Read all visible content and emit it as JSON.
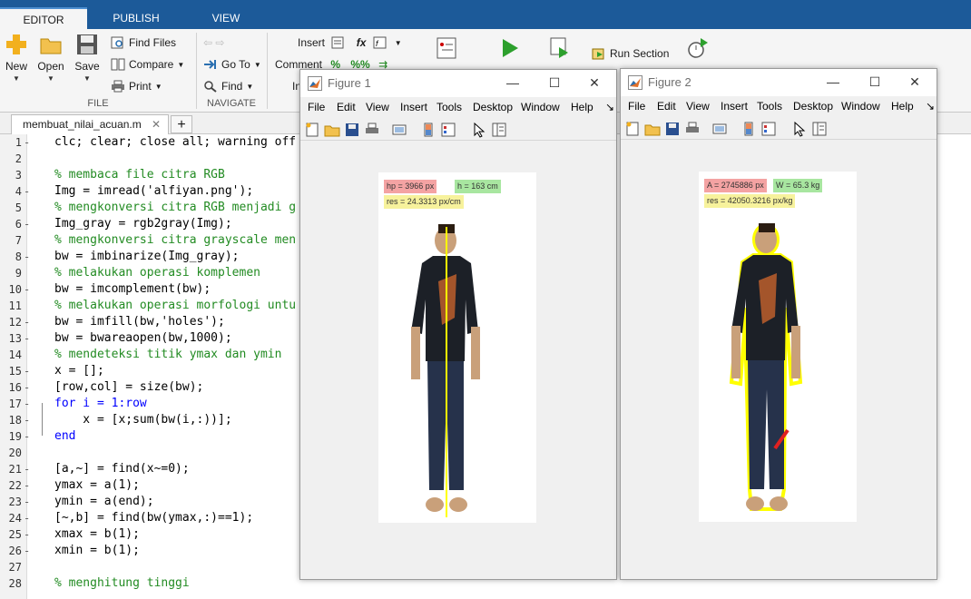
{
  "tabs": [
    {
      "label": "EDITOR",
      "active": true
    },
    {
      "label": "PUBLISH",
      "active": false
    },
    {
      "label": "VIEW",
      "active": false
    }
  ],
  "toolstrip": {
    "file": {
      "new_label": "New",
      "open_label": "Open",
      "save_label": "Save",
      "find_files_label": "Find Files",
      "compare_label": "Compare",
      "print_label": "Print",
      "section_label": "FILE"
    },
    "navigate": {
      "go_to_label": "Go To",
      "find_label": "Find",
      "section_label": "NAVIGATE"
    },
    "edit": {
      "insert_label": "Insert",
      "comment_label": "Comment",
      "indent_label": "In"
    },
    "run": {
      "run_section_label": "Run Section"
    }
  },
  "editor": {
    "file_tab": "membuat_nilai_acuan.m",
    "lines": [
      {
        "n": "1",
        "text": "clc; clear; close all; warning off"
      },
      {
        "n": "2",
        "text": ""
      },
      {
        "n": "3",
        "text": "% membaca file citra RGB"
      },
      {
        "n": "4",
        "text": "Img = imread('alfiyan.png');"
      },
      {
        "n": "5",
        "text": "% mengkonversi citra RGB menjadi g"
      },
      {
        "n": "6",
        "text": "Img_gray = rgb2gray(Img);"
      },
      {
        "n": "7",
        "text": "% mengkonversi citra grayscale men"
      },
      {
        "n": "8",
        "text": "bw = imbinarize(Img_gray);"
      },
      {
        "n": "9",
        "text": "% melakukan operasi komplemen"
      },
      {
        "n": "10",
        "text": "bw = imcomplement(bw);"
      },
      {
        "n": "11",
        "text": "% melakukan operasi morfologi untu"
      },
      {
        "n": "12",
        "text": "bw = imfill(bw,'holes');"
      },
      {
        "n": "13",
        "text": "bw = bwareaopen(bw,1000);"
      },
      {
        "n": "14",
        "text": "% mendeteksi titik ymax dan ymin"
      },
      {
        "n": "15",
        "text": "x = [];"
      },
      {
        "n": "16",
        "text": "[row,col] = size(bw);"
      },
      {
        "n": "17",
        "text": "for i = 1:row"
      },
      {
        "n": "18",
        "text": "    x = [x;sum(bw(i,:))];"
      },
      {
        "n": "19",
        "text": "end"
      },
      {
        "n": "20",
        "text": ""
      },
      {
        "n": "21",
        "text": "[a,~] = find(x~=0);"
      },
      {
        "n": "22",
        "text": "ymax = a(1);"
      },
      {
        "n": "23",
        "text": "ymin = a(end);"
      },
      {
        "n": "24",
        "text": "[~,b] = find(bw(ymax,:)==1);"
      },
      {
        "n": "25",
        "text": "xmax = b(1);"
      },
      {
        "n": "26",
        "text": "xmin = b(1);"
      },
      {
        "n": "27",
        "text": ""
      },
      {
        "n": "28",
        "text": "% menghitung tinggi"
      }
    ]
  },
  "figure1": {
    "title": "Figure 1",
    "menu": [
      "File",
      "Edit",
      "View",
      "Insert",
      "Tools",
      "Desktop",
      "Window",
      "Help"
    ],
    "labels": {
      "hp": "hp = 3966 px",
      "h": "h = 163 cm",
      "res": "res = 24.3313 px/cm"
    },
    "colors": {
      "hp": "#f4a3a3",
      "h": "#a8e6a0",
      "res": "#f7f29c",
      "line": "#ffff00"
    }
  },
  "figure2": {
    "title": "Figure 2",
    "menu": [
      "File",
      "Edit",
      "View",
      "Insert",
      "Tools",
      "Desktop",
      "Window",
      "Help"
    ],
    "labels": {
      "a": "A = 2745886 px",
      "w": "W = 65.3 kg",
      "res": "res = 42050.3216 px/kg"
    },
    "colors": {
      "a": "#f4a3a3",
      "w": "#a8e6a0",
      "res": "#f7f29c",
      "outline": "#ffff00"
    }
  },
  "icons": [
    "new-icon",
    "open-folder-icon",
    "save-icon",
    "find-files-icon",
    "compare-icon",
    "print-icon",
    "back-arrow-icon",
    "forward-arrow-icon",
    "go-to-icon",
    "find-icon",
    "insert-icon",
    "fx-icon",
    "comment-icon",
    "indent-icon",
    "breakpoints-icon",
    "run-icon",
    "run-and-advance-icon",
    "run-section-icon",
    "run-and-time-icon",
    "matlab-logo-icon",
    "minimize-icon",
    "maximize-icon",
    "close-icon"
  ]
}
